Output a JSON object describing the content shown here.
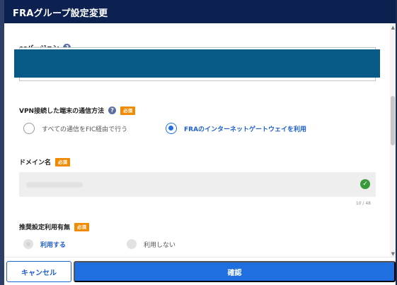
{
  "dialog": {
    "title": "FRAグループ設定変更"
  },
  "os_version": {
    "label": "osバージョン",
    "help_icon": "help-icon"
  },
  "vpn": {
    "label": "VPN接続した端末の通信方法",
    "required": "必須",
    "options": [
      {
        "label": "すべての通信をFIC経由で行う",
        "selected": false
      },
      {
        "label": "FRAのインターネットゲートウェイを利用",
        "selected": true
      }
    ]
  },
  "domain": {
    "label": "ドメイン名",
    "required": "必須",
    "counter": "10 / 48",
    "valid_icon": "check-icon"
  },
  "recommended": {
    "label": "推奨設定利用有無",
    "required": "必須",
    "options": [
      {
        "label": "利用する",
        "selected": true
      },
      {
        "label": "利用しない",
        "selected": false
      }
    ]
  },
  "footer": {
    "cancel_label": "キャンセル",
    "confirm_label": "確認"
  },
  "colors": {
    "header_bg": "#0c2150",
    "primary": "#1f6fe0",
    "required_badge": "#f08a00",
    "redaction": "#075a85",
    "valid": "#3a9a3a"
  }
}
